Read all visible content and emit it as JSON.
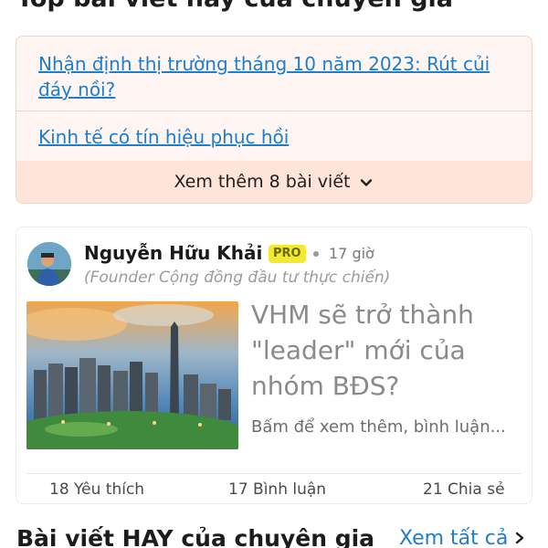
{
  "top_section": {
    "title": "Top bài viết hay của chuyên gia",
    "articles": [
      {
        "title": "Nhận định thị trường tháng 10 năm 2023: Rút củi đáy nồi?"
      },
      {
        "title": "Kinh tế có tín hiệu phục hồi"
      }
    ],
    "more_label": "Xem thêm 8 bài viết"
  },
  "post": {
    "author": "Nguyễn Hữu Khải",
    "badge": "PRO",
    "time": "17 giờ",
    "author_sub": "(Founder Cộng đồng đầu tư thực chiến)",
    "title": "VHM sẽ trở thành \"leader\" mới của nhóm BĐS?",
    "excerpt": "Bấm để xem thêm, bình luận...",
    "stats": {
      "likes": "18 Yêu thích",
      "comments": "17 Bình luận",
      "shares": "21 Chia sẻ"
    }
  },
  "bottom_section": {
    "title": "Bài viết HAY của chuyên gia",
    "see_all": "Xem tất cả"
  },
  "colors": {
    "link": "#1f7dcc",
    "card_bg": "#fff5f2",
    "more_bar_bg": "#ffe4da",
    "badge_bg": "#f3ea2f"
  }
}
